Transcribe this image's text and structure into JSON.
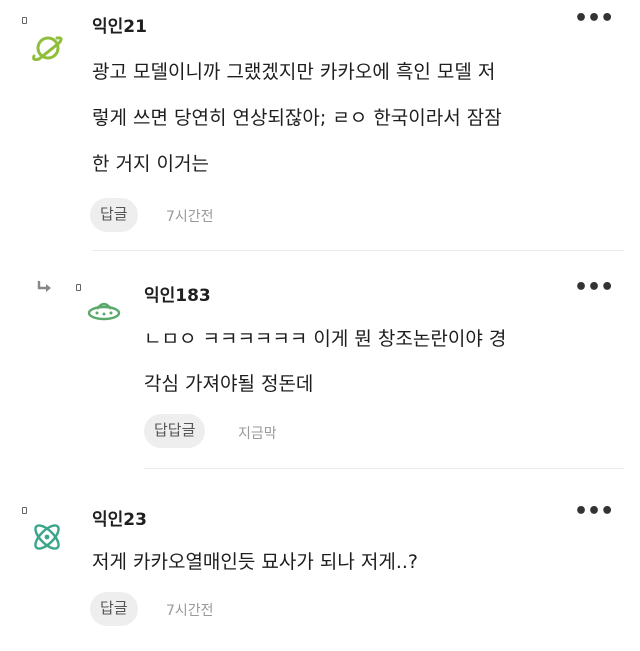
{
  "comments": [
    {
      "nickname": "익인21",
      "text_lines": [
        "광고 모델이니까 그랬겠지만 카카오에 흑인 모델 저",
        "렇게 쓰면 당연히 연상되잖아; ㄹㅇ 한국이라서 잠잠",
        "한 거지 이거는"
      ],
      "reply_label": "답글",
      "time": "7시간전",
      "avatar_icon": "planet-icon",
      "more_label": "•••"
    },
    {
      "nickname": "익인183",
      "text_lines": [
        "ㄴㅁㅇ ㅋㅋㅋㅋㅋㅋ 이게 뭔 창조논란이야 경",
        "각심 가져야될 정돈데"
      ],
      "reply_label": "답답글",
      "time": "지금막",
      "avatar_icon": "ufo-icon",
      "more_label": "•••"
    },
    {
      "nickname": "익인23",
      "text_lines": [
        "저게 카카오열매인듯 묘사가 되나 저게..?"
      ],
      "reply_label": "답글",
      "time": "7시간전",
      "avatar_icon": "atom-icon",
      "more_label": "•••"
    }
  ],
  "colors": {
    "avatar_green": "#8fbf3a",
    "avatar_teal": "#3aa58a",
    "ufo_green": "#5aa86a"
  }
}
